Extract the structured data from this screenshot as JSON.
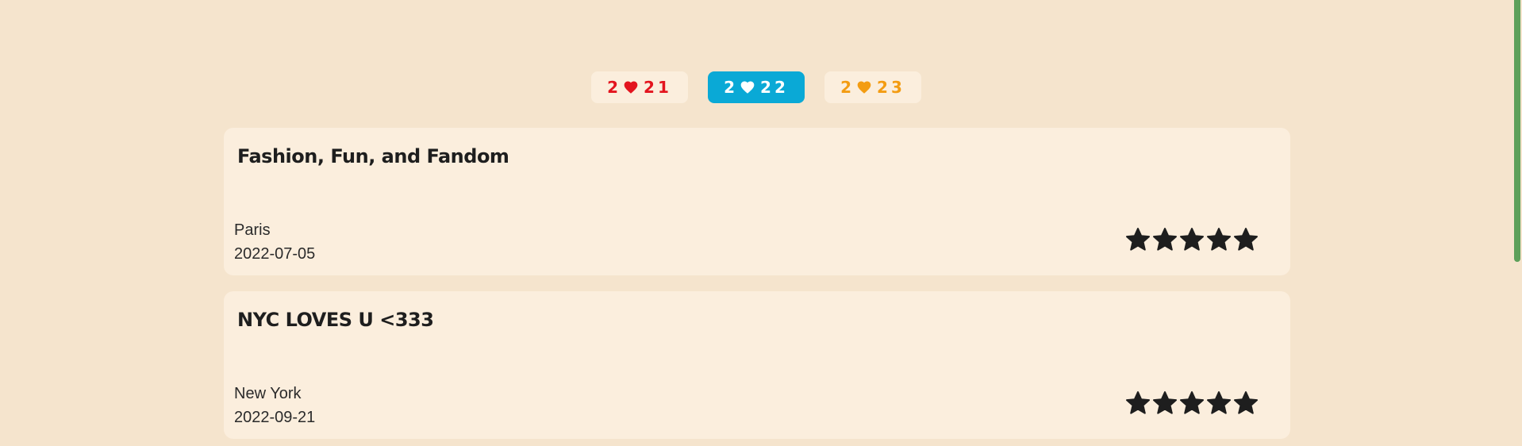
{
  "year_tabs": [
    {
      "digits_a": "2",
      "digits_b": "21",
      "color": "#e3141e",
      "active": false
    },
    {
      "digits_a": "2",
      "digits_b": "22",
      "color": "#ffffff",
      "active": true
    },
    {
      "digits_a": "2",
      "digits_b": "23",
      "color": "#f39c12",
      "active": false
    }
  ],
  "cards": [
    {
      "title": "Fashion, Fun, and Fandom",
      "city": "Paris",
      "date": "2022-07-05",
      "rating": 5
    },
    {
      "title": "NYC LOVES U <333",
      "city": "New York",
      "date": "2022-09-21",
      "rating": 5
    }
  ],
  "colors": {
    "background": "#f5e4cd",
    "card": "#fbeedd",
    "active_tab": "#0aa9d6",
    "scrollbar": "#5da05a"
  },
  "icons": {
    "tab_icon": "heart-icon",
    "rating_icon": "star-icon"
  }
}
